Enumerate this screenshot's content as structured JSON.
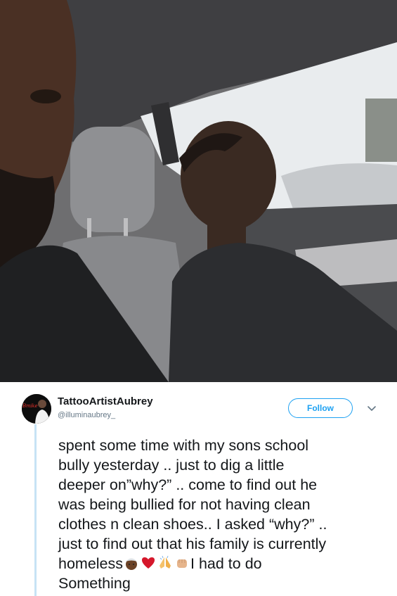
{
  "tweet": {
    "display_name": "TattooArtistAubrey",
    "handle": "@illuminaubrey_",
    "follow_label": "Follow",
    "avatar_text": "Bmike",
    "text_before_emoji": "spent some time with my sons school\nbully yesterday .. just to dig a little\ndeeper on”why?” .. come to find out he\nwas being bullied for not having clean\nclothes n clean shoes.. I asked “why?” ..\njust to find out that his family is currently\nhomeless",
    "emojis": [
      "person-with-turban-icon",
      "red-heart-icon",
      "folded-hands-icon",
      "raised-fist-icon"
    ],
    "text_after_emoji": "I had to do\nSomething"
  },
  "colors": {
    "follow_blue": "#1da1f2",
    "thread_line": "#c7e3f5",
    "text": "#14171a",
    "secondary_text": "#657786"
  }
}
